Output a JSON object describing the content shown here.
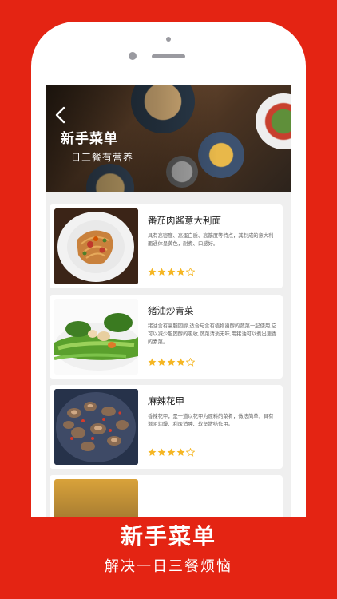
{
  "banner": {
    "title": "新手菜单",
    "subtitle": "一日三餐有营养"
  },
  "recipes": [
    {
      "title": "番茄肉酱意大利面",
      "desc": "具有高密度、高蛋白质、高筋度等特点，其制成的意大利面通体呈黄色，耐煮、口感好。",
      "rating": 4.5,
      "max_rating": 5
    },
    {
      "title": "猪油炒青菜",
      "desc": "猪油含有高胆固醇,适合与含有植物甾醇的蔬菜一起使用,它可以减少胆固醇的吸收,蔬菜清淡无味,用猪油可以煮出更香的素菜。",
      "rating": 4.5,
      "max_rating": 5
    },
    {
      "title": "麻辣花甲",
      "desc": "香辣花甲，是一道以花甲为原料的菜肴，做法简单，具有滋阴润燥、利尿消肿、软坚散结作用。",
      "rating": 4.5,
      "max_rating": 5
    }
  ],
  "caption": {
    "title": "新手菜单",
    "subtitle": "解决一日三餐烦恼"
  },
  "colors": {
    "background": "#e42413",
    "star": "#f5b623",
    "star_empty": "#d9d9d9"
  }
}
